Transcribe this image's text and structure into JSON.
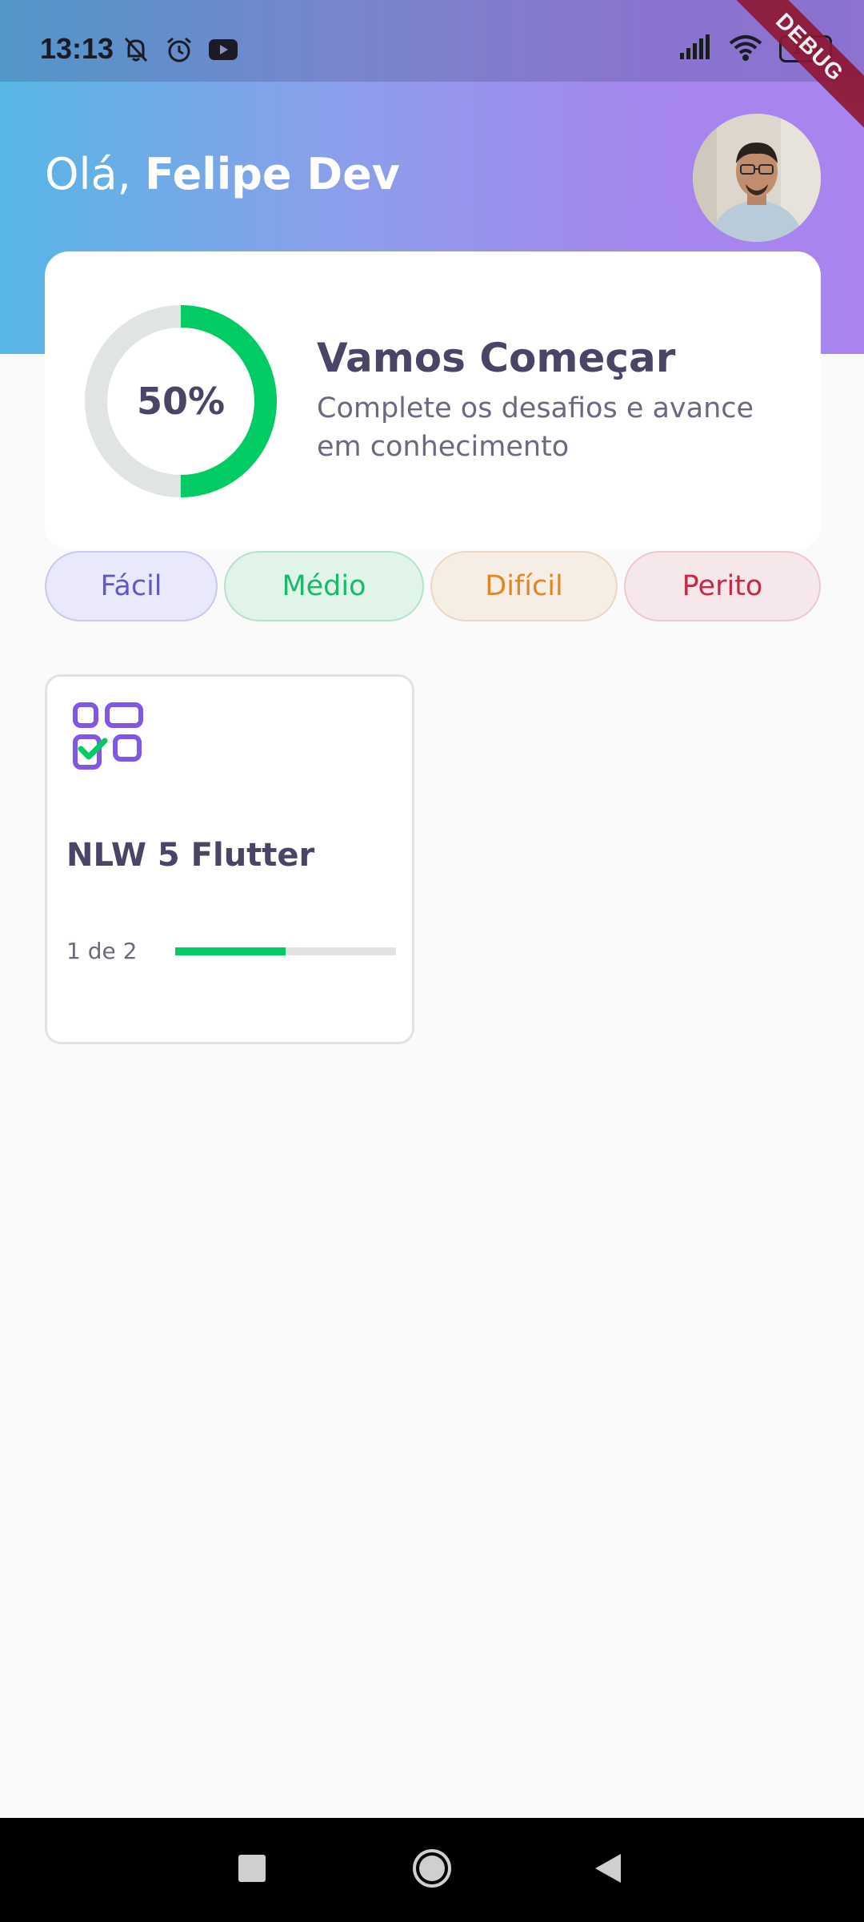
{
  "status_bar": {
    "time": "13:13",
    "battery": "100",
    "debug_label": "DEBUG"
  },
  "header": {
    "greeting_prefix": "Olá, ",
    "user_name": "Felipe Dev"
  },
  "score_card": {
    "percent": 0.5,
    "percent_label": "50%",
    "title": "Vamos Começar",
    "subtitle": "Complete os desafios e avance em conhecimento"
  },
  "levels": [
    {
      "label": "Fácil"
    },
    {
      "label": "Médio"
    },
    {
      "label": "Difícil"
    },
    {
      "label": "Perito"
    }
  ],
  "quizzes": [
    {
      "title": "NLW 5 Flutter",
      "progress_label": "1 de 2",
      "progress": 0.5
    }
  ],
  "colors": {
    "primary": "#00cc63",
    "heading": "#4a4566",
    "purple": "#8257e5"
  },
  "icons": {
    "status_left": [
      "bell-off-icon",
      "alarm-icon",
      "youtube-icon"
    ],
    "status_right": [
      "signal-icon",
      "wifi-icon",
      "battery-icon"
    ],
    "nav": [
      "square-icon",
      "circle-icon",
      "triangle-back-icon"
    ]
  }
}
